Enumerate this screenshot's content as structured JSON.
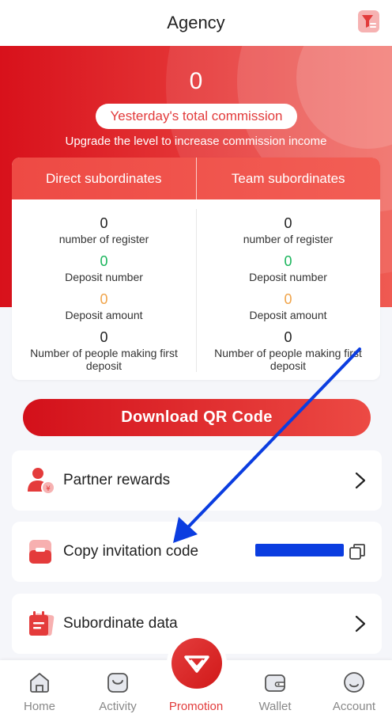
{
  "header": {
    "title": "Agency",
    "filter_icon": "filter-icon"
  },
  "hero": {
    "commission_value": "0",
    "commission_label": "Yesterday's total commission",
    "upgrade_text": "Upgrade the level to increase commission income"
  },
  "stats": {
    "direct": {
      "title": "Direct subordinates",
      "register_value": "0",
      "register_label": "number of register",
      "deposit_number_value": "0",
      "deposit_number_label": "Deposit number",
      "deposit_amount_value": "0",
      "deposit_amount_label": "Deposit amount",
      "first_deposit_value": "0",
      "first_deposit_label": "Number of people making first deposit"
    },
    "team": {
      "title": "Team subordinates",
      "register_value": "0",
      "register_label": "number of register",
      "deposit_number_value": "0",
      "deposit_number_label": "Deposit number",
      "deposit_amount_value": "0",
      "deposit_amount_label": "Deposit amount",
      "first_deposit_value": "0",
      "first_deposit_label": "Number of people making first deposit"
    }
  },
  "qr_button_label": "Download QR Code",
  "menu": {
    "partner_rewards": "Partner rewards",
    "copy_invitation": "Copy invitation code",
    "subordinate_data": "Subordinate data"
  },
  "tabs": {
    "home": "Home",
    "activity": "Activity",
    "promotion": "Promotion",
    "wallet": "Wallet",
    "account": "Account"
  },
  "colors": {
    "brand_red": "#e23b3b",
    "green": "#1bb55c",
    "orange": "#f0a44a",
    "annotation_blue": "#0b3de0"
  }
}
